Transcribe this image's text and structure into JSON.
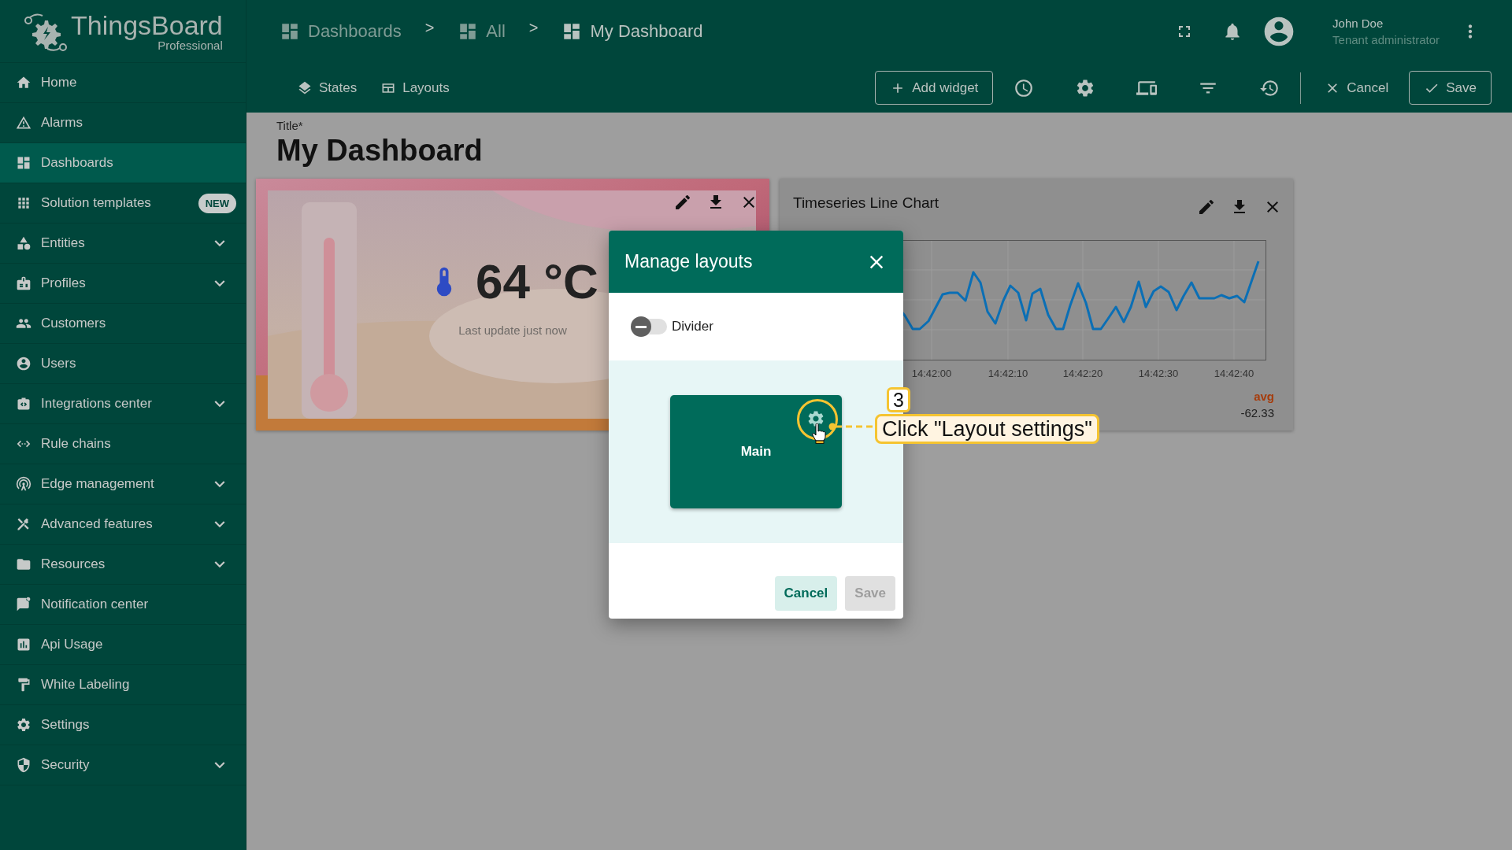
{
  "logo": {
    "name": "ThingsBoard",
    "edition": "Professional"
  },
  "breadcrumbs": [
    {
      "kind": "crumb",
      "label": "Dashboards",
      "selected": false
    },
    {
      "kind": "separator",
      "label": ">"
    },
    {
      "kind": "crumb",
      "label": "All",
      "selected": false
    },
    {
      "kind": "separator",
      "label": ">"
    },
    {
      "kind": "crumb",
      "label": "My Dashboard",
      "selected": true
    }
  ],
  "user": {
    "name": "John Doe",
    "role": "Tenant administrator"
  },
  "toolbar": {
    "tabs": [
      {
        "label": "States"
      },
      {
        "label": "Layouts"
      }
    ],
    "add_widget": "Add widget",
    "cancel": "Cancel",
    "save": "Save"
  },
  "sidebar": {
    "items": [
      {
        "kind": "link",
        "label": "Home",
        "selected": false
      },
      {
        "kind": "link",
        "label": "Alarms",
        "selected": false
      },
      {
        "kind": "link",
        "label": "Dashboards",
        "selected": true
      },
      {
        "kind": "link",
        "label": "Solution templates",
        "selected": false,
        "badge": "NEW"
      },
      {
        "kind": "group",
        "label": "Entities",
        "selected": false,
        "expanded": false
      },
      {
        "kind": "group",
        "label": "Profiles",
        "selected": false,
        "expanded": false
      },
      {
        "kind": "link",
        "label": "Customers",
        "selected": false
      },
      {
        "kind": "link",
        "label": "Users",
        "selected": false
      },
      {
        "kind": "group",
        "label": "Integrations center",
        "selected": false,
        "expanded": false
      },
      {
        "kind": "link",
        "label": "Rule chains",
        "selected": false
      },
      {
        "kind": "group",
        "label": "Edge management",
        "selected": false,
        "expanded": false
      },
      {
        "kind": "group",
        "label": "Advanced features",
        "selected": false,
        "expanded": false
      },
      {
        "kind": "group",
        "label": "Resources",
        "selected": false,
        "expanded": false
      },
      {
        "kind": "link",
        "label": "Notification center",
        "selected": false
      },
      {
        "kind": "link",
        "label": "Api Usage",
        "selected": false
      },
      {
        "kind": "link",
        "label": "White Labeling",
        "selected": false
      },
      {
        "kind": "link",
        "label": "Settings",
        "selected": false
      },
      {
        "kind": "group",
        "label": "Security",
        "selected": false,
        "expanded": false
      }
    ]
  },
  "title_field": {
    "label": "Title*",
    "value": "My Dashboard"
  },
  "widgets": [
    {
      "kind": "value_card",
      "value": "64 °C",
      "caption": "Last update just now"
    },
    {
      "kind": "line_chart",
      "title": "Timeseries Line Chart",
      "x_ticks": [
        "14:42:00",
        "14:42:10",
        "14:42:20",
        "14:42:30",
        "14:42:40"
      ],
      "legend": {
        "label": "avg",
        "value": "-62.33"
      }
    }
  ],
  "dialog": {
    "title": "Manage layouts",
    "divider": {
      "label": "Divider",
      "on": false
    },
    "layouts": [
      {
        "name": "Main"
      }
    ],
    "buttons": [
      {
        "label": "Cancel",
        "disabled": false
      },
      {
        "label": "Save",
        "disabled": true
      }
    ]
  },
  "annotation": {
    "step": "3",
    "text": "Click \"Layout settings\""
  }
}
